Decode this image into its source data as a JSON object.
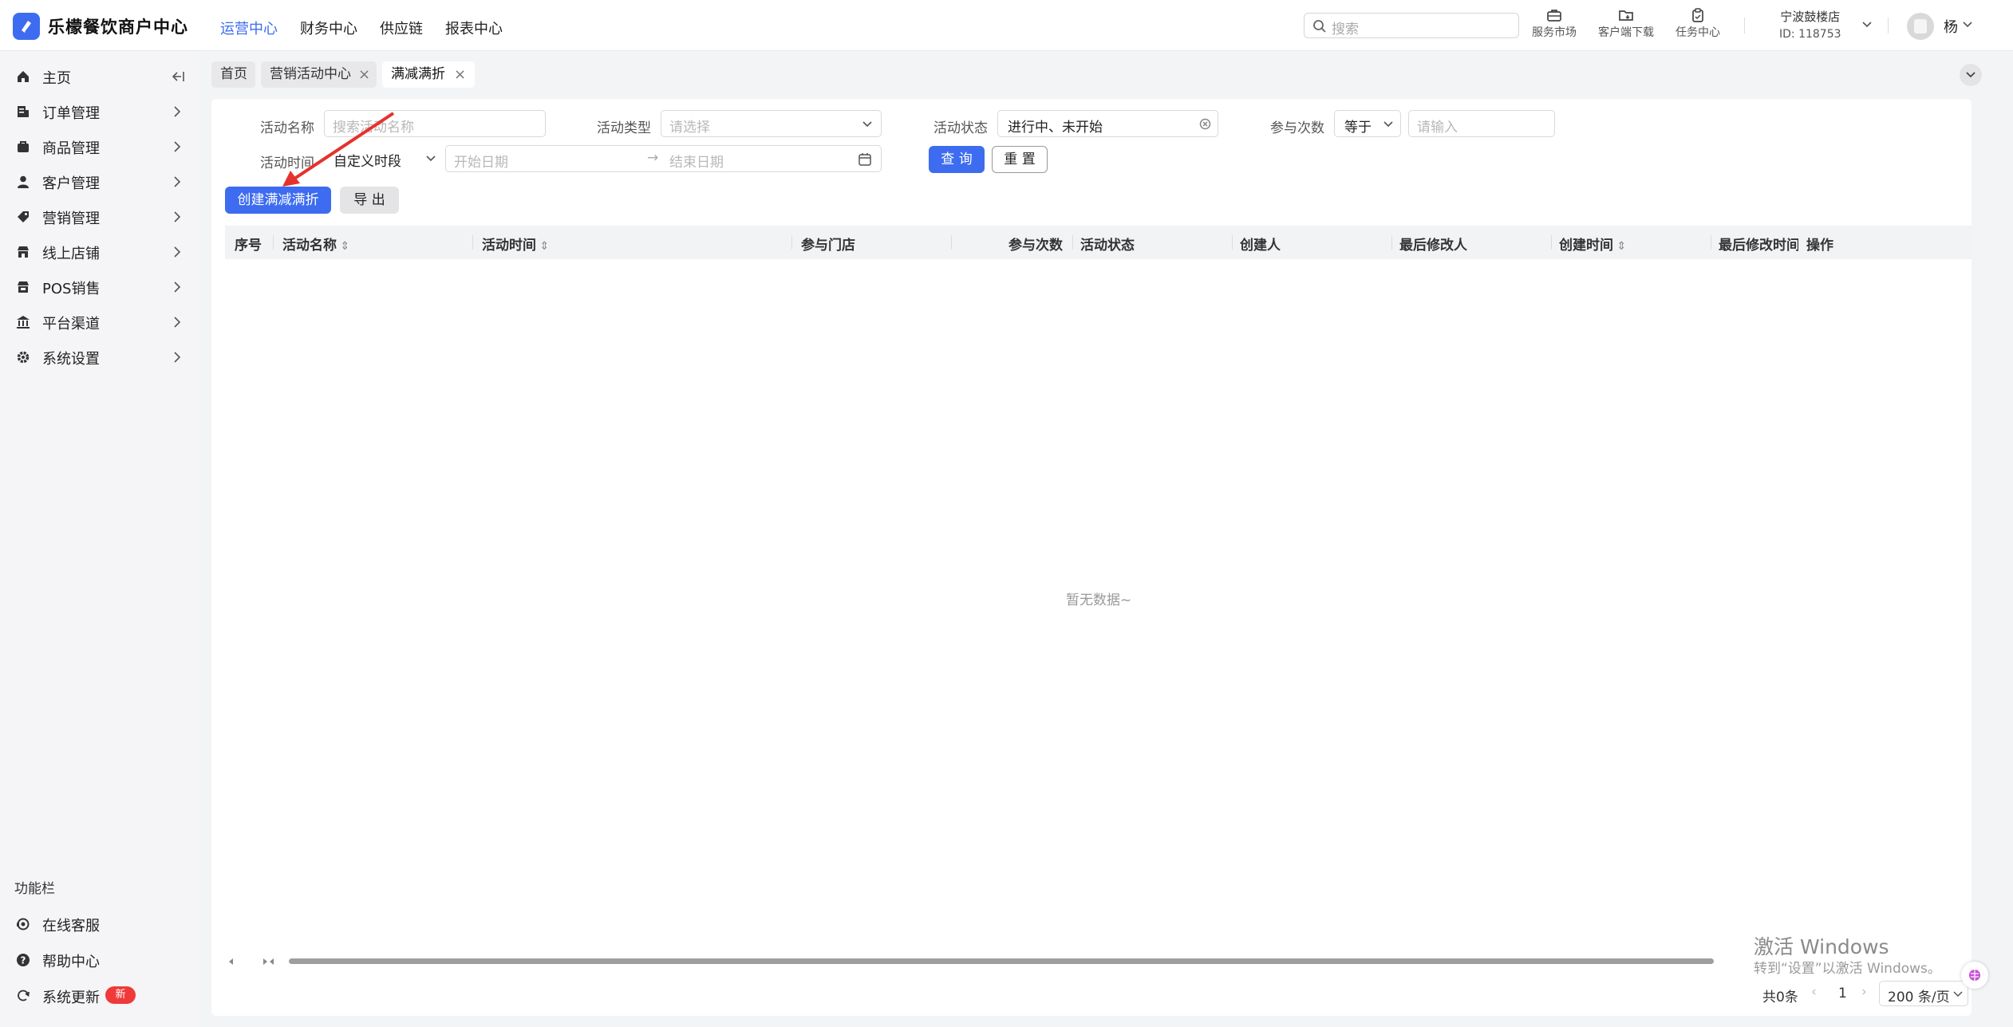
{
  "brand": {
    "name": "乐檬餐饮商户中心"
  },
  "topnav": [
    "运营中心",
    "财务中心",
    "供应链",
    "报表中心"
  ],
  "search": {
    "placeholder": "搜索"
  },
  "tools": [
    {
      "label": "服务市场",
      "icon": "store-icon"
    },
    {
      "label": "客户端下载",
      "icon": "folder-download-icon"
    },
    {
      "label": "任务中心",
      "icon": "clipboard-icon"
    }
  ],
  "store": {
    "name": "宁波鼓楼店",
    "id": "ID: 118753"
  },
  "user": {
    "name": "杨"
  },
  "sidebar": {
    "items": [
      {
        "label": "主页",
        "icon": "home-icon"
      },
      {
        "label": "订单管理",
        "icon": "order-icon"
      },
      {
        "label": "商品管理",
        "icon": "goods-icon"
      },
      {
        "label": "客户管理",
        "icon": "user-icon"
      },
      {
        "label": "营销管理",
        "icon": "tag-icon"
      },
      {
        "label": "线上店铺",
        "icon": "shop-icon"
      },
      {
        "label": "POS销售",
        "icon": "pos-icon"
      },
      {
        "label": "平台渠道",
        "icon": "bank-icon"
      },
      {
        "label": "系统设置",
        "icon": "gear-icon"
      }
    ],
    "func_title": "功能栏",
    "func_items": [
      {
        "label": "在线客服",
        "icon": "headset-icon"
      },
      {
        "label": "帮助中心",
        "icon": "help-icon"
      },
      {
        "label": "系统更新",
        "icon": "refresh-icon"
      }
    ],
    "new_badge": "新"
  },
  "tabs": [
    {
      "label": "首页"
    },
    {
      "label": "营销活动中心"
    },
    {
      "label": "满减满折"
    }
  ],
  "filters": {
    "name_label": "活动名称",
    "name_placeholder": "搜索活动名称",
    "type_label": "活动类型",
    "type_placeholder": "请选择",
    "status_label": "活动状态",
    "status_value": "进行中、未开始",
    "count_label": "参与次数",
    "count_op": "等于",
    "count_placeholder": "请输入",
    "time_label": "活动时间",
    "time_mode": "自定义时段",
    "start_placeholder": "开始日期",
    "end_placeholder": "结束日期",
    "query": "查 询",
    "reset": "重 置"
  },
  "actions": {
    "create": "创建满减满折",
    "export": "导 出"
  },
  "table": {
    "columns": [
      "序号",
      "活动名称",
      "活动时间",
      "参与门店",
      "参与次数",
      "活动状态",
      "创建人",
      "最后修改人",
      "创建时间",
      "最后修改时间",
      "操作"
    ],
    "empty": "暂无数据~"
  },
  "pager": {
    "total": "共0条",
    "page": "1",
    "size": "200 条/页"
  },
  "watermark": {
    "line1": "激活 Windows",
    "line2": "转到“设置”以激活 Windows。"
  },
  "colors": {
    "primary": "#3d6cf0",
    "badge": "#f03a3a",
    "annotation_arrow": "#e5322d"
  }
}
